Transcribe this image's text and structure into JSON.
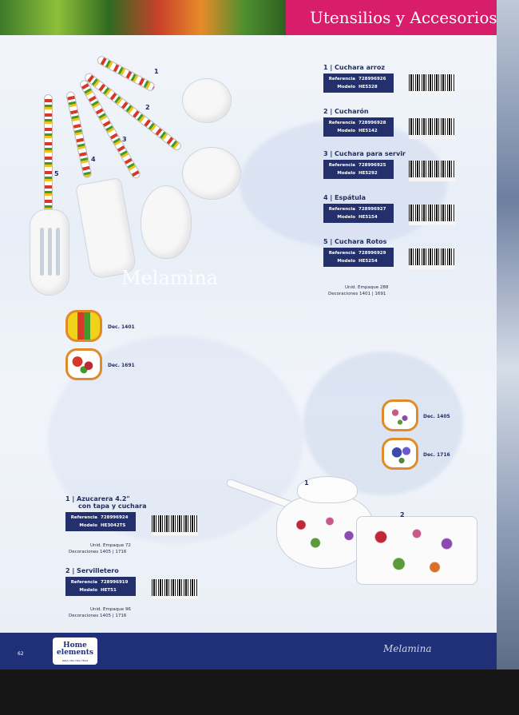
{
  "header": {
    "title": "Utensilios y Accesorios"
  },
  "section_watermark": "Melamina",
  "utensils": {
    "callout_numbers": [
      "1",
      "2",
      "3",
      "4",
      "5"
    ],
    "items": [
      {
        "title": "1 | Cuchara arroz",
        "ref_label": "Referencia",
        "ref": "728996926",
        "model_label": "Modelo",
        "model": "HE5328"
      },
      {
        "title": "2 | Cucharón",
        "ref_label": "Referencia",
        "ref": "728996928",
        "model_label": "Modelo",
        "model": "HE5142"
      },
      {
        "title": "3 | Cuchara para servir",
        "ref_label": "Referencia",
        "ref": "728996925",
        "model_label": "Modelo",
        "model": "HE5292"
      },
      {
        "title": "4 | Espátula",
        "ref_label": "Referencia",
        "ref": "728996927",
        "model_label": "Modelo",
        "model": "HE5154"
      },
      {
        "title": "5 | Cuchara Rotos",
        "ref_label": "Referencia",
        "ref": "728996929",
        "model_label": "Modelo",
        "model": "HE5254"
      }
    ],
    "unid": "Unid. Empaque 288",
    "decoraciones": "Decoraciones 1401 | 1691"
  },
  "decorations_left": [
    {
      "label": "Dec. 1401"
    },
    {
      "label": "Dec. 1691"
    }
  ],
  "decorations_right": [
    {
      "label": "Dec. 1405"
    },
    {
      "label": "Dec. 1716"
    }
  ],
  "tableware": {
    "callout_numbers": [
      "1",
      "2"
    ],
    "items": [
      {
        "title": "1 | Azucarera 4.2\"",
        "subtitle": "con tapa y cuchara",
        "ref_label": "Referencia",
        "ref": "728996924",
        "model_label": "Modelo",
        "model": "HE3042TS",
        "unid": "Unid. Empaque 72",
        "decoraciones": "Decoraciones 1405 | 1716"
      },
      {
        "title": "2 | Servilletero",
        "subtitle": "",
        "ref_label": "Referencia",
        "ref": "728996919",
        "model_label": "Modelo",
        "model": "HET51",
        "unid": "Unid. Empaque 96",
        "decoraciones": "Decoraciones 1405 | 1716"
      }
    ]
  },
  "footer": {
    "page_number": "62",
    "brand": "Home elements",
    "tagline": "PARA UNA VIDA FELIZ",
    "section": "Melamina"
  }
}
